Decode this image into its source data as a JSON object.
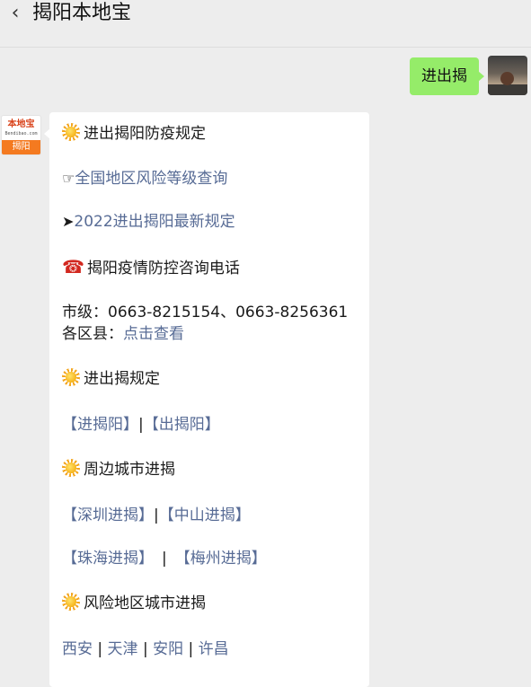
{
  "header": {
    "back_icon": "chevron-left-icon",
    "back_glyph": "‹",
    "title": "揭阳本地宝"
  },
  "user_message": {
    "text": "进出揭"
  },
  "bot": {
    "avatar": {
      "logo_text": "本地宝",
      "logo_sub": "Bendibao.com",
      "city": "揭阳"
    },
    "rules_heading": "进出揭阳防疫规定",
    "risk_query": {
      "icon": "☞",
      "text": "全国地区风险等级查询"
    },
    "latest_rules": {
      "icon": "➤",
      "text": "2022进出揭阳最新规定"
    },
    "hotline_heading": {
      "icon": "☎",
      "text": "揭阳疫情防控咨询电话"
    },
    "city_level": "市级：0663-8215154、0663-8256361",
    "county_prefix": "各区县：",
    "county_link": "点击查看",
    "section_rules": "进出揭规定",
    "enter_link": "【进揭阳】",
    "bar": "|",
    "exit_link": "【出揭阳】",
    "section_nearby": "周边城市进揭",
    "shenzhen": "【深圳进揭】",
    "zhongshan": "【中山进揭】",
    "zhuhai": "【珠海进揭】",
    "bar_spaced": "|",
    "meizhou": "【梅州进揭】",
    "section_risk": "风险地区城市进揭",
    "cities": [
      "西安",
      "天津",
      "安阳",
      "许昌"
    ]
  }
}
